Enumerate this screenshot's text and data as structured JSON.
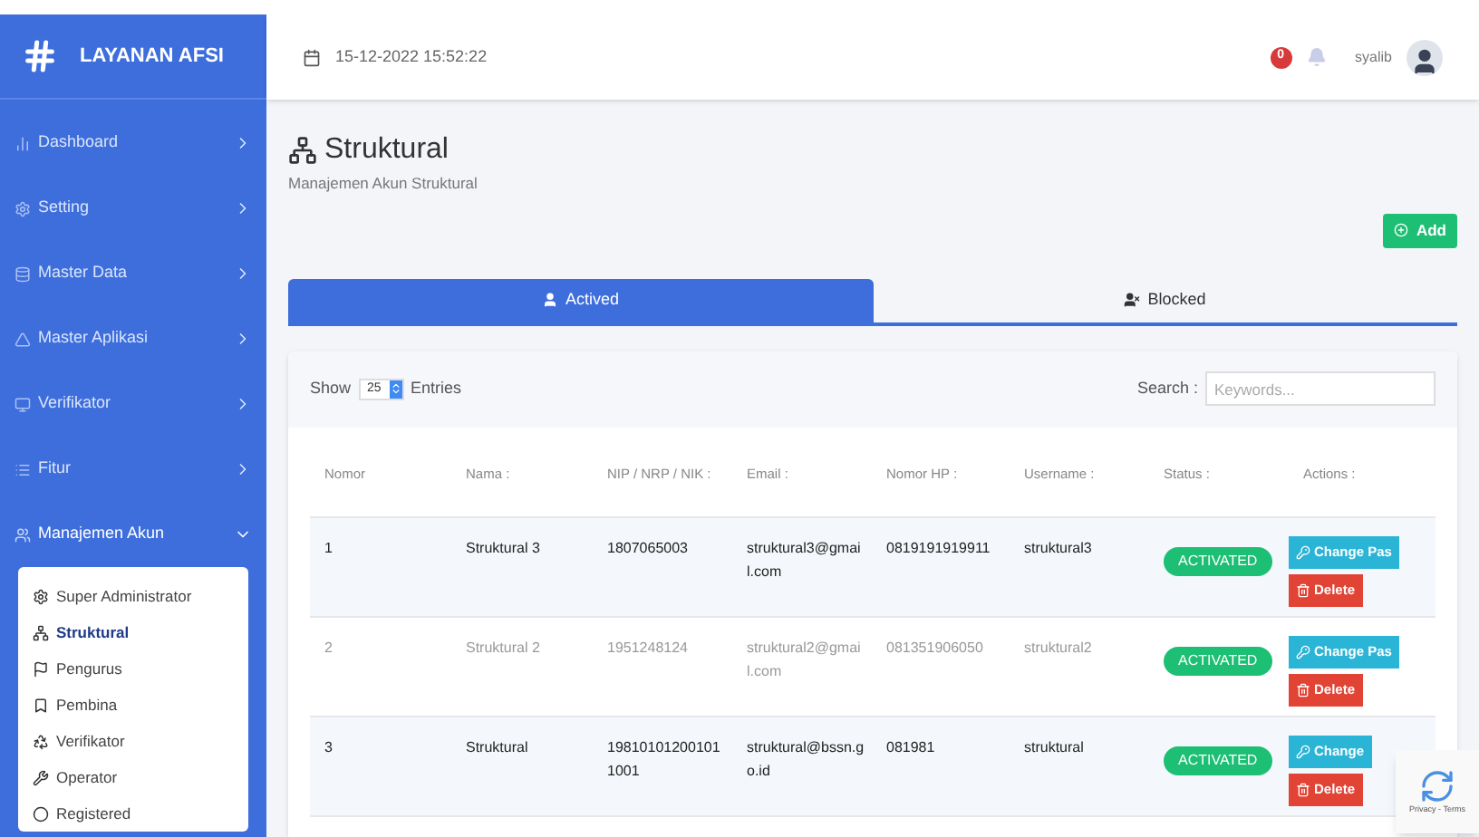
{
  "brand": "LAYANAN AFSI",
  "sidebar": {
    "items": [
      {
        "label": "Dashboard",
        "expanded": false
      },
      {
        "label": "Setting",
        "expanded": false
      },
      {
        "label": "Master Data",
        "expanded": false
      },
      {
        "label": "Master Aplikasi",
        "expanded": false
      },
      {
        "label": "Verifikator",
        "expanded": false
      },
      {
        "label": "Fitur",
        "expanded": false
      },
      {
        "label": "Manajemen Akun",
        "expanded": true,
        "children": [
          {
            "label": "Super Administrator",
            "selected": false
          },
          {
            "label": "Struktural",
            "selected": true
          },
          {
            "label": "Pengurus",
            "selected": false
          },
          {
            "label": "Pembina",
            "selected": false
          },
          {
            "label": "Verifikator",
            "selected": false
          },
          {
            "label": "Operator",
            "selected": false
          },
          {
            "label": "Registered",
            "selected": false
          }
        ]
      }
    ]
  },
  "header": {
    "datetime": "15-12-2022 15:52:22",
    "notification_count": "0",
    "username": "syalib"
  },
  "page": {
    "title": "Struktural",
    "subtitle": "Manajemen Akun Struktural",
    "add_button": "Add"
  },
  "tabs": [
    {
      "label": "Actived",
      "selected": true
    },
    {
      "label": "Blocked",
      "selected": false
    }
  ],
  "table_controls": {
    "show_label": "Show",
    "page_size": "25",
    "entries_label": "Entries",
    "search_label": "Search :",
    "search_placeholder": "Keywords..."
  },
  "table": {
    "columns": [
      "Nomor",
      "Nama :",
      "NIP / NRP / NIK :",
      "Email :",
      "Nomor HP :",
      "Username :",
      "Status :",
      "Actions :"
    ],
    "rows": [
      {
        "cells": [
          "1",
          "Struktural 3",
          "1807065003",
          "struktural3@gmail.com",
          "0819191919911",
          "struktural3"
        ],
        "status": "ACTIVATED",
        "actions": [
          "Change Pas",
          "Delete"
        ]
      },
      {
        "cells": [
          "2",
          "Struktural 2",
          "1951248124",
          "struktural2@gmail.com",
          "081351906050",
          "struktural2"
        ],
        "status": "ACTIVATED",
        "actions": [
          "Change Pas",
          "Delete"
        ]
      },
      {
        "cells": [
          "3",
          "Struktural",
          "198101012001011001",
          "struktural@bssn.go.id",
          "081981",
          "struktural"
        ],
        "status": "ACTIVATED",
        "actions": [
          "Change",
          "Delete"
        ]
      }
    ]
  },
  "recaptcha": {
    "text": "Privacy - Terms"
  }
}
